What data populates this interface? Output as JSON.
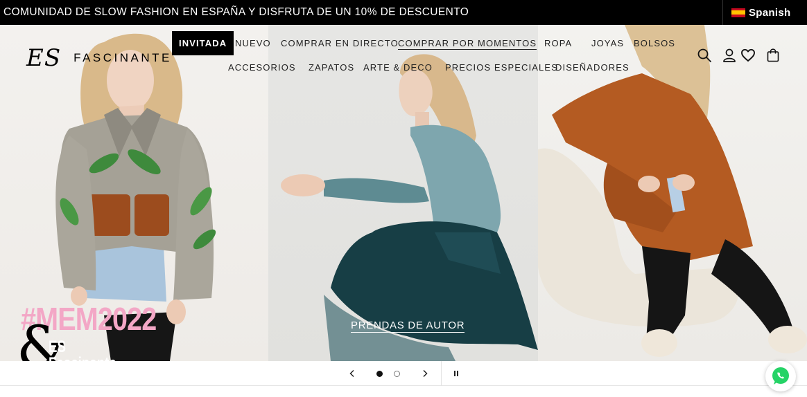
{
  "announcement": {
    "text": "COMUNIDAD DE SLOW FASHION EN ESPAÑA Y DISFRUTA DE UN 10% DE DESCUENTO",
    "language_label": "Spanish",
    "language_flag": "spain-flag-icon"
  },
  "logo": {
    "mark": "ES",
    "name": "FASCINANTE"
  },
  "nav": {
    "row1": [
      "INVITADA",
      "NUEVO",
      "COMPRAR EN DIRECTO",
      "COMPRAR POR MOMENTOS",
      "ROPA",
      "JOYAS",
      "BOLSOS"
    ],
    "row2": [
      "ACCESORIOS",
      "ZAPATOS",
      "ARTE & DECO",
      "PRECIOS ESPECIALES",
      "DISEÑADORES"
    ],
    "active": "INVITADA",
    "underlined": "COMPRAR POR MOMENTOS"
  },
  "header_icons": [
    "search-icon",
    "account-icon",
    "wishlist-heart-icon",
    "cart-bag-icon"
  ],
  "hero": {
    "promo_tag": "#MEM2022",
    "promo_amp": "&",
    "promo_name": "ES Fascinante",
    "cta_label": "PRENDAS DE AUTOR"
  },
  "slider": {
    "prev_icon": "chevron-left-icon",
    "next_icon": "chevron-right-icon",
    "pause_icon": "pause-icon",
    "slide_count": 2,
    "current_slide": 1
  },
  "floating": {
    "whatsapp_icon": "whatsapp-icon"
  },
  "colors": {
    "announcement_bg": "#000000",
    "promo_pink": "#f3a7c6",
    "whatsapp_green": "#25d366"
  }
}
